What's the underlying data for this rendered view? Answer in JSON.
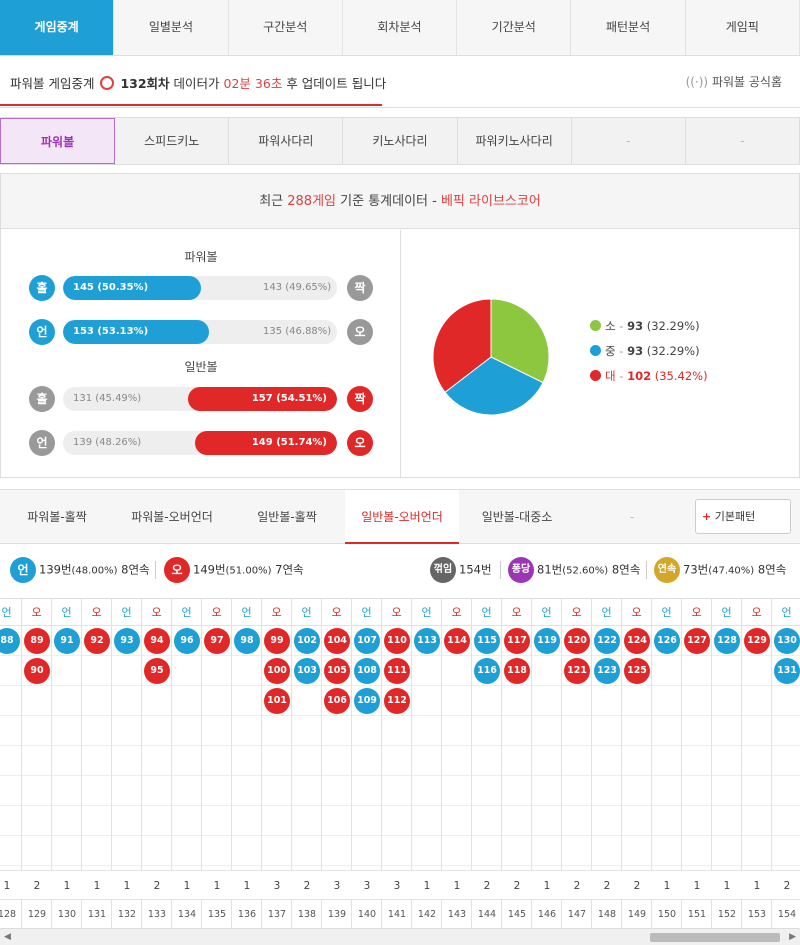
{
  "topnav": [
    "게임중계",
    "일별분석",
    "구간분석",
    "회차분석",
    "기간분석",
    "패턴분석",
    "게임픽"
  ],
  "info": {
    "prefix": "파워볼 게임중계",
    "round": "132회차",
    "mid": "데이터가",
    "time": "02분 36초",
    "suffix": "후 업데이트 됩니다",
    "official": "파워볼 공식홈"
  },
  "subnav": [
    "파워볼",
    "스피드키노",
    "파워사다리",
    "키노사다리",
    "파워키노사다리",
    "-",
    "-"
  ],
  "stat_header": {
    "prefix": "최근",
    "count": "288게임",
    "mid": "기준 통계데이터 -",
    "brand": "베픽 라이브스코어"
  },
  "powerball_title": "파워볼",
  "normal_title": "일반볼",
  "powerball_rows": [
    {
      "lcirc": "홀",
      "rcirc": "짝",
      "left": "145 (50.35%)",
      "right": "143 (49.65%)",
      "lpct": 50.35,
      "lead": "left",
      "color": "#1e9fd6"
    },
    {
      "lcirc": "언",
      "rcirc": "오",
      "left": "153 (53.13%)",
      "right": "135 (46.88%)",
      "lpct": 53.13,
      "lead": "left",
      "color": "#1e9fd6"
    }
  ],
  "normal_rows": [
    {
      "lcirc": "홀",
      "rcirc": "짝",
      "left": "131 (45.49%)",
      "right": "157 (54.51%)",
      "lpct": 45.49,
      "lead": "right",
      "color": "#e02828"
    },
    {
      "lcirc": "언",
      "rcirc": "오",
      "left": "139 (48.26%)",
      "right": "149 (51.74%)",
      "lpct": 48.26,
      "lead": "right",
      "color": "#e02828"
    }
  ],
  "pie": {
    "slices": [
      {
        "label": "소",
        "count": "93",
        "pct": "(32.29%)",
        "value": 32.29,
        "color": "#8dc63f"
      },
      {
        "label": "중",
        "count": "93",
        "pct": "(32.29%)",
        "value": 32.29,
        "color": "#1e9fd6"
      },
      {
        "label": "대",
        "count": "102",
        "pct": "(35.42%)",
        "value": 35.42,
        "color": "#e02828"
      }
    ]
  },
  "tabs2": [
    "파워볼-홀짝",
    "파워볼-오버언더",
    "일반볼-홀짝",
    "일반볼-오버언더",
    "일반볼-대중소",
    "-"
  ],
  "tabs2_button": "기본패턴",
  "summary": {
    "under": {
      "c": "언",
      "n": "139번",
      "p": "(48.00%)",
      "s": "8연속"
    },
    "over": {
      "c": "오",
      "n": "149번",
      "p": "(51.00%)",
      "s": "7연속"
    },
    "kk": {
      "c": "꺾임",
      "n": "154번"
    },
    "pd": {
      "c": "퐁당",
      "n": "81번",
      "p": "(52.60%)",
      "s": "8연속"
    },
    "ys": {
      "c": "연속",
      "n": "73번",
      "p": "(47.40%)",
      "s": "8연속"
    }
  },
  "columns": [
    {
      "h": "언",
      "t": "u",
      "b": [
        "88"
      ],
      "c": "1",
      "r": "128"
    },
    {
      "h": "오",
      "t": "o",
      "b": [
        "89",
        "90"
      ],
      "c": "2",
      "r": "129"
    },
    {
      "h": "언",
      "t": "u",
      "b": [
        "91"
      ],
      "c": "1",
      "r": "130"
    },
    {
      "h": "오",
      "t": "o",
      "b": [
        "92"
      ],
      "c": "1",
      "r": "131"
    },
    {
      "h": "언",
      "t": "u",
      "b": [
        "93"
      ],
      "c": "1",
      "r": "132"
    },
    {
      "h": "오",
      "t": "o",
      "b": [
        "94",
        "95"
      ],
      "c": "2",
      "r": "133"
    },
    {
      "h": "언",
      "t": "u",
      "b": [
        "96"
      ],
      "c": "1",
      "r": "134"
    },
    {
      "h": "오",
      "t": "o",
      "b": [
        "97"
      ],
      "c": "1",
      "r": "135"
    },
    {
      "h": "언",
      "t": "u",
      "b": [
        "98"
      ],
      "c": "1",
      "r": "136"
    },
    {
      "h": "오",
      "t": "o",
      "b": [
        "99",
        "100",
        "101"
      ],
      "c": "3",
      "r": "137"
    },
    {
      "h": "언",
      "t": "u",
      "b": [
        "102",
        "103"
      ],
      "c": "2",
      "r": "138"
    },
    {
      "h": "오",
      "t": "o",
      "b": [
        "104",
        "105",
        "106"
      ],
      "c": "3",
      "r": "139"
    },
    {
      "h": "언",
      "t": "u",
      "b": [
        "107",
        "108",
        "109"
      ],
      "c": "3",
      "r": "140"
    },
    {
      "h": "오",
      "t": "o",
      "b": [
        "110",
        "111",
        "112"
      ],
      "c": "3",
      "r": "141"
    },
    {
      "h": "언",
      "t": "u",
      "b": [
        "113"
      ],
      "c": "1",
      "r": "142"
    },
    {
      "h": "오",
      "t": "o",
      "b": [
        "114"
      ],
      "c": "1",
      "r": "143"
    },
    {
      "h": "언",
      "t": "u",
      "b": [
        "115",
        "116"
      ],
      "c": "2",
      "r": "144"
    },
    {
      "h": "오",
      "t": "o",
      "b": [
        "117",
        "118"
      ],
      "c": "2",
      "r": "145"
    },
    {
      "h": "언",
      "t": "u",
      "b": [
        "119"
      ],
      "c": "1",
      "r": "146"
    },
    {
      "h": "오",
      "t": "o",
      "b": [
        "120",
        "121"
      ],
      "c": "2",
      "r": "147"
    },
    {
      "h": "언",
      "t": "u",
      "b": [
        "122",
        "123"
      ],
      "c": "2",
      "r": "148"
    },
    {
      "h": "오",
      "t": "o",
      "b": [
        "124",
        "125"
      ],
      "c": "2",
      "r": "149"
    },
    {
      "h": "언",
      "t": "u",
      "b": [
        "126"
      ],
      "c": "1",
      "r": "150"
    },
    {
      "h": "오",
      "t": "o",
      "b": [
        "127"
      ],
      "c": "1",
      "r": "151"
    },
    {
      "h": "언",
      "t": "u",
      "b": [
        "128"
      ],
      "c": "1",
      "r": "152"
    },
    {
      "h": "오",
      "t": "o",
      "b": [
        "129"
      ],
      "c": "1",
      "r": "153"
    },
    {
      "h": "언",
      "t": "u",
      "b": [
        "130",
        "131"
      ],
      "c": "2",
      "r": "154"
    }
  ],
  "colors": {
    "blue": "#1e9fd6",
    "red": "#e02828",
    "purple": "#9b37b3",
    "gray": "#666666",
    "gold": "#d4a62a"
  }
}
